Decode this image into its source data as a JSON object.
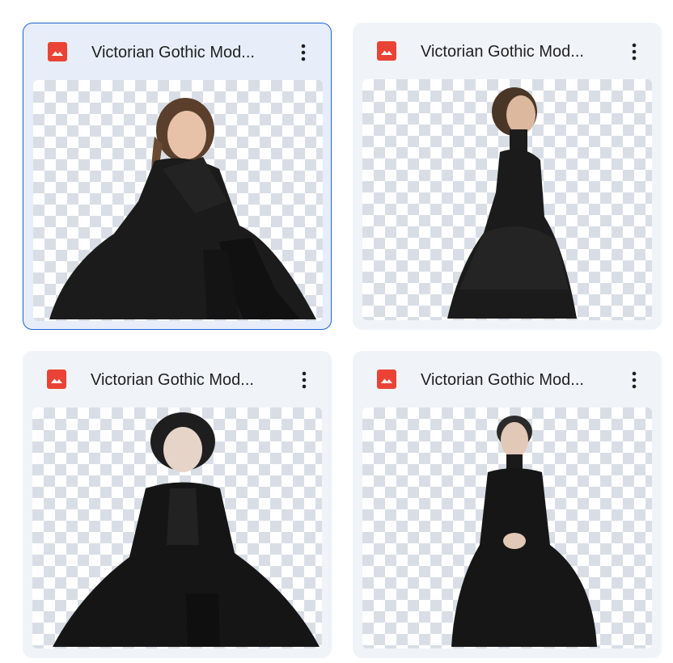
{
  "files": [
    {
      "title": "Victorian Gothic Mod...",
      "icon": "image-file-icon",
      "selected": true
    },
    {
      "title": "Victorian Gothic Mod...",
      "icon": "image-file-icon",
      "selected": false
    },
    {
      "title": "Victorian Gothic Mod...",
      "icon": "image-file-icon",
      "selected": false
    },
    {
      "title": "Victorian Gothic Mod...",
      "icon": "image-file-icon",
      "selected": false
    }
  ],
  "colors": {
    "icon_red": "#ea4335",
    "selection_border": "#1a64d6",
    "card_bg": "#f0f4f9"
  }
}
